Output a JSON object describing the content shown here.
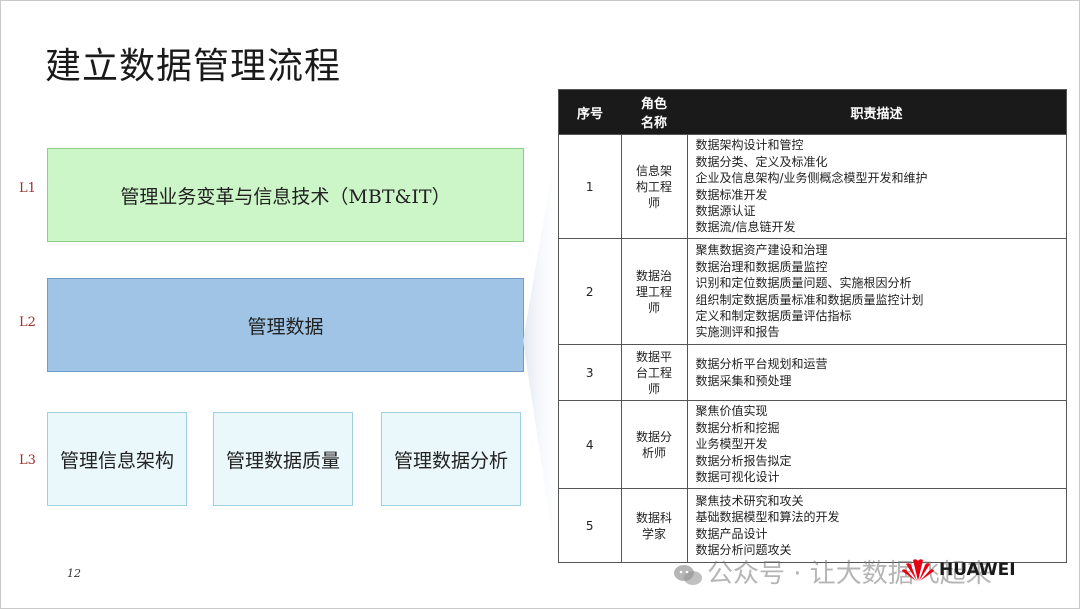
{
  "title": "建立数据管理流程",
  "levels": {
    "l1": {
      "label": "L1",
      "box": "管理业务变革与信息技术（MBT&IT）"
    },
    "l2": {
      "label": "L2",
      "box": "管理数据"
    },
    "l3": {
      "label": "L3",
      "boxes": [
        "管理信息架构",
        "管理数据质量",
        "管理数据分析"
      ]
    }
  },
  "table": {
    "headers": [
      "序号",
      "角色\n名称",
      "职责描述"
    ],
    "rows": [
      {
        "num": "1",
        "role": "信息架\n构工程\n师",
        "desc": [
          "数据架构设计和管控",
          "数据分类、定义及标准化",
          "企业及信息架构/业务侧概念模型开发和维护",
          "数据标准开发",
          "数据源认证",
          "数据流/信息链开发"
        ]
      },
      {
        "num": "2",
        "role": "数据治\n理工程\n师",
        "desc": [
          "聚焦数据资产建设和治理",
          "数据治理和数据质量监控",
          "识别和定位数据质量问题、实施根因分析",
          "组织制定数据质量标准和数据质量监控计划",
          "定义和制定数据质量评估指标",
          "实施测评和报告"
        ]
      },
      {
        "num": "3",
        "role": "数据平\n台工程\n师",
        "desc": [
          "数据分析平台规划和运营",
          "数据采集和预处理"
        ]
      },
      {
        "num": "4",
        "role": "数据分\n析师",
        "desc": [
          "聚焦价值实现",
          "数据分析和挖掘",
          "业务模型开发",
          "数据分析报告拟定",
          "数据可视化设计"
        ]
      },
      {
        "num": "5",
        "role": "数据科\n学家",
        "desc": [
          "聚焦技术研究和攻关",
          "基础数据模型和算法的开发",
          "数据产品设计",
          "数据分析问题攻关"
        ]
      }
    ]
  },
  "page_number": "12",
  "watermark": "公众号 · 让大数据飞起来",
  "logo": {
    "text": "HUAWEI",
    "color": "#e60012",
    "icon": "huawei-petal-logo"
  },
  "colors": {
    "l1": "#ccf5c8",
    "l2": "#9fc4e6",
    "l3": "#eaf7fb",
    "header": "#1a1a1a"
  }
}
